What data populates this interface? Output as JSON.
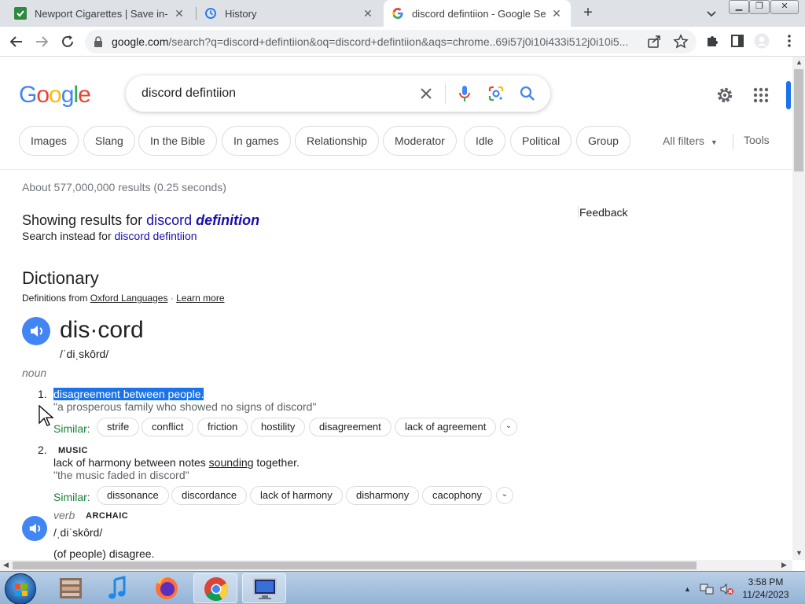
{
  "browser": {
    "tabs": [
      {
        "label": "Newport Cigarettes | Save in-sto",
        "icon": "newport-favicon"
      },
      {
        "label": "History",
        "icon": "history-icon"
      },
      {
        "label": "discord defintiion - Google Searc",
        "icon": "google-favicon"
      }
    ],
    "url_domain": "google.com",
    "url_rest": "/search?q=discord+defintiion&oq=discord+defintiion&aqs=chrome..69i57j0i10i433i512j0i10i5..."
  },
  "google": {
    "logo": [
      "G",
      "o",
      "o",
      "g",
      "l",
      "e"
    ],
    "logo_colors": [
      "#4285f4",
      "#ea4335",
      "#fbbc05",
      "#4285f4",
      "#34a853",
      "#ea4335"
    ],
    "query": "discord defintiion",
    "chips": [
      "Images",
      "Slang",
      "In the Bible",
      "In games",
      "Relationship",
      "Moderator",
      "Idle",
      "Political",
      "Group"
    ],
    "all_filters": "All filters",
    "tools": "Tools"
  },
  "results": {
    "stats": "About 577,000,000 results (0.25 seconds)",
    "showing_prefix": "Showing results for ",
    "showing_word": "discord ",
    "showing_corrected": "definition",
    "instead_prefix": "Search instead for ",
    "instead_link": "discord defintiion",
    "feedback": "Feedback"
  },
  "dictionary": {
    "title": "Dictionary",
    "source_prefix": "Definitions from ",
    "source_link": "Oxford Languages",
    "source_sep": " · ",
    "learn_more": "Learn more",
    "headword": "dis·cord",
    "pronunciation": "/ˈdiˌskôrd/",
    "noun_label": "noun",
    "senses": [
      {
        "number": "1.",
        "definition": "disagreement between people.",
        "example": "\"a prosperous family who showed no signs of discord\"",
        "similar_label": "Similar:",
        "similar": [
          "strife",
          "conflict",
          "friction",
          "hostility",
          "disagreement",
          "lack of agreement"
        ]
      },
      {
        "number": "2.",
        "tag": "MUSIC",
        "definition_prefix": "lack of harmony between notes ",
        "definition_link": "sounding",
        "definition_suffix": " together.",
        "example": "\"the music faded in discord\"",
        "similar_label": "Similar:",
        "similar": [
          "dissonance",
          "discordance",
          "lack of harmony",
          "disharmony",
          "cacophony"
        ]
      }
    ],
    "verb_label": "verb",
    "verb_tag": "ARCHAIC",
    "verb_pronunciation": "/ˌdiˈskôrd/",
    "verb_definition": "(of people) disagree."
  },
  "taskbar": {
    "apps": [
      "file-manager-icon",
      "itunes-icon",
      "firefox-icon",
      "chrome-icon",
      "remote-desktop-icon"
    ],
    "time": "3:58 PM",
    "date": "11/24/2023"
  }
}
